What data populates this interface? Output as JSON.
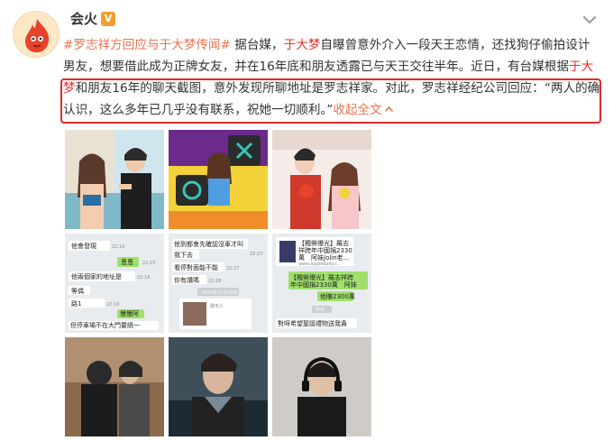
{
  "author": {
    "name": "会火",
    "verified_badge": "V",
    "avatar_icon": "fire-mascot-icon"
  },
  "post": {
    "topic": "#罗志祥方回应与于大梦传闻#",
    "segments": [
      {
        "type": "text",
        "text": " 据台媒，"
      },
      {
        "type": "name",
        "text": "于大梦"
      },
      {
        "type": "text",
        "text": "自曝曾意外介入一段天王恋情，还找狗仔偷拍设计男友，想要借此成为正牌女友，并在16年底和朋友透露已与天王交往半年。近日，有台媒根据"
      },
      {
        "type": "name",
        "text": "于大梦"
      },
      {
        "type": "text",
        "text": "和朋友16年的聊天截图，意外发现所聊地址是罗志祥家。对此，罗志祥经纪公司回应：“两人的确认识，这么多年已几乎没有联系，祝她一切顺利。”"
      }
    ],
    "expand_label": "收起全文",
    "expand_icon": "chevron-up-icon"
  },
  "colors": {
    "topic": "#eb7350",
    "name_highlight": "#e8302b",
    "annotation_box": "#e02b28"
  },
  "images": {
    "chat1": {
      "lines": [
        "他會發現",
        "恩恩",
        "他兩個家的地址是",
        "等偶",
        "路1",
        "慢慢阿",
        "但停車場不在大門要繞一"
      ],
      "times": [
        "22:16",
        "22:15",
        "22:16",
        "22:16",
        "22:16",
        "22:16"
      ]
    },
    "chat2": {
      "lines": [
        "他到都會先確認沒車才叫",
        "我下去",
        "看停對面能不能",
        "你有講嗎",
        "2016年11月30日",
        "聊天人"
      ],
      "times": [
        "22:27",
        "22:27",
        "22:28"
      ]
    },
    "chat3": {
      "lines": [
        "【獨勞爆光】羅志",
        "祥跨年中國捐2330",
        "萬　阿妹Jolin老...",
        "www.appledaily.c...",
        "【獨勞爆光】羅志祥跨",
        "年中國捐2330萬　阿妹",
        "他賺2300萬",
        "昨天",
        "對呀希望聖誕禮物送我貴"
      ]
    }
  }
}
